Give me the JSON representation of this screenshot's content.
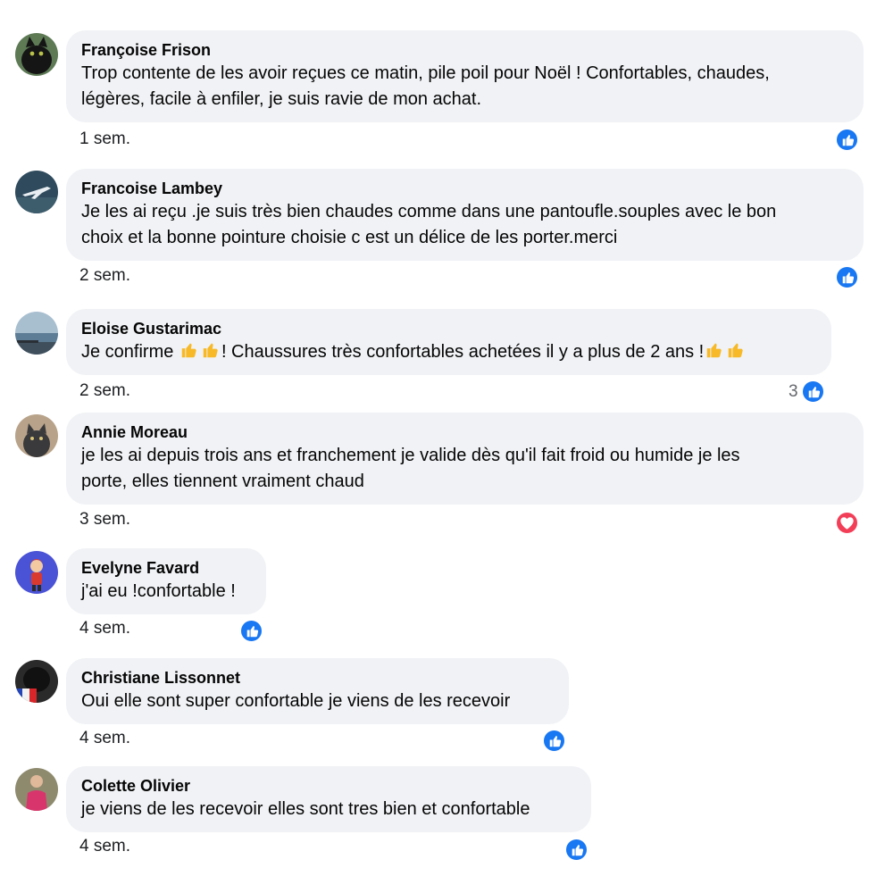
{
  "comments": [
    {
      "author": "Françoise Frison",
      "lines": [
        "Trop contente de les avoir reçues ce matin, pile poil pour Noël ! Confortables, chaudes,",
        "légères, facile à enfiler, je suis ravie de mon achat."
      ],
      "time": "1 sem.",
      "reaction": "like-icon",
      "reaction_count": ""
    },
    {
      "author": "Francoise Lambey",
      "lines": [
        "Je les ai reçu .je suis très bien chaudes comme dans une pantoufle.souples avec le bon",
        "choix et la bonne pointure choisie c est un délice de les porter.merci"
      ],
      "time": "2 sem.",
      "reaction": "like-icon",
      "reaction_count": ""
    },
    {
      "author": "Eloise Gustarimac",
      "text_parts": [
        "Je confirme ",
        "! Chaussures très confortables achetées il y a plus de 2 ans !"
      ],
      "emoji": "thumbs-up-emoji",
      "time": "2 sem.",
      "reaction": "like-icon",
      "reaction_count": "3"
    },
    {
      "author": "Annie Moreau",
      "lines": [
        "je les ai depuis trois ans et franchement je valide dès qu'il fait froid ou humide je les",
        "porte, elles tiennent vraiment chaud"
      ],
      "time": "3 sem.",
      "reaction": "heart-icon",
      "reaction_count": ""
    },
    {
      "author": "Evelyne Favard",
      "lines": [
        "j'ai eu !confortable !"
      ],
      "time": "4 sem.",
      "reaction": "like-icon",
      "reaction_count": ""
    },
    {
      "author": "Christiane Lissonnet",
      "lines": [
        "Oui elle sont super confortable je viens de les recevoir"
      ],
      "time": "4 sem.",
      "reaction": "like-icon",
      "reaction_count": ""
    },
    {
      "author": "Colette Olivier",
      "lines": [
        "je viens de les recevoir elles sont tres bien et confortable"
      ],
      "time": "4 sem.",
      "reaction": "like-icon",
      "reaction_count": ""
    }
  ],
  "colors": {
    "bubble": "#f0f2f5",
    "like": "#1877f2",
    "love": "#f33e58",
    "emoji": "#f7b928"
  }
}
